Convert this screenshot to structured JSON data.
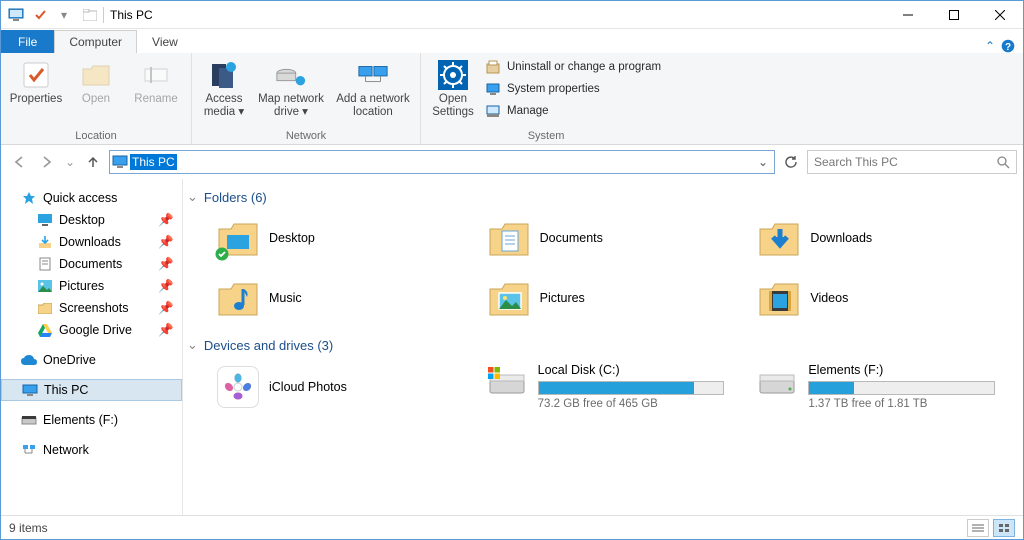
{
  "title": "This PC",
  "tabs": {
    "file": "File",
    "computer": "Computer",
    "view": "View"
  },
  "ribbon": {
    "location": {
      "label": "Location",
      "properties": "Properties",
      "open": "Open",
      "rename": "Rename"
    },
    "network": {
      "label": "Network",
      "access": "Access media",
      "map": "Map network drive",
      "add": "Add a network location"
    },
    "system": {
      "label": "System",
      "settings": "Open Settings",
      "uninstall": "Uninstall or change a program",
      "props": "System properties",
      "manage": "Manage"
    }
  },
  "address": {
    "text": "This PC"
  },
  "search": {
    "placeholder": "Search This PC"
  },
  "sidebar": {
    "quick": "Quick access",
    "items": [
      {
        "label": "Desktop"
      },
      {
        "label": "Downloads"
      },
      {
        "label": "Documents"
      },
      {
        "label": "Pictures"
      },
      {
        "label": "Screenshots"
      },
      {
        "label": "Google Drive"
      }
    ],
    "onedrive": "OneDrive",
    "thispc": "This PC",
    "elements": "Elements (F:)",
    "network": "Network"
  },
  "groups": {
    "folders": {
      "title": "Folders (6)",
      "items": [
        "Desktop",
        "Documents",
        "Downloads",
        "Music",
        "Pictures",
        "Videos"
      ]
    },
    "devices": {
      "title": "Devices and drives (3)",
      "icloud": "iCloud Photos",
      "drives": [
        {
          "name": "Local Disk (C:)",
          "free": "73.2 GB free of 465 GB",
          "fill": 84
        },
        {
          "name": "Elements (F:)",
          "free": "1.37 TB free of 1.81 TB",
          "fill": 24
        }
      ]
    }
  },
  "status": {
    "count": "9 items"
  }
}
